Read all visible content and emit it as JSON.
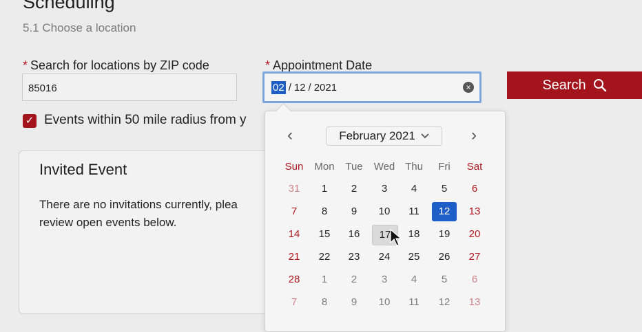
{
  "page": {
    "title": "Scheduling",
    "subtitle": "5.1 Choose a location"
  },
  "form": {
    "required_mark": "*",
    "zip_label": "Search for locations by ZIP code",
    "zip_value": "85016",
    "date_label": "Appointment Date",
    "date_month": "02",
    "date_day": "12",
    "date_year": "2021",
    "date_separator": "/",
    "search_label": "Search",
    "radius_text": "Events within 50 mile radius from y"
  },
  "invited_event": {
    "title": "Invited Event",
    "line1": "There are no invitations currently, plea",
    "line2": "review open events below."
  },
  "calendar": {
    "month_label": "February 2021",
    "weekdays": [
      "Sun",
      "Mon",
      "Tue",
      "Wed",
      "Thu",
      "Fri",
      "Sat"
    ],
    "weeks": [
      [
        "31",
        "1",
        "2",
        "3",
        "4",
        "5",
        "6"
      ],
      [
        "7",
        "8",
        "9",
        "10",
        "11",
        "12",
        "13"
      ],
      [
        "14",
        "15",
        "16",
        "17",
        "18",
        "19",
        "20"
      ],
      [
        "21",
        "22",
        "23",
        "24",
        "25",
        "26",
        "27"
      ],
      [
        "28",
        "1",
        "2",
        "3",
        "4",
        "5",
        "6"
      ],
      [
        "7",
        "8",
        "9",
        "10",
        "11",
        "12",
        "13"
      ]
    ],
    "selected_day": "12",
    "hovered_day": "17"
  },
  "colors": {
    "accent": "#a3141d",
    "selected_blue": "#1d5fc6",
    "focus_border": "#7da6dc"
  }
}
